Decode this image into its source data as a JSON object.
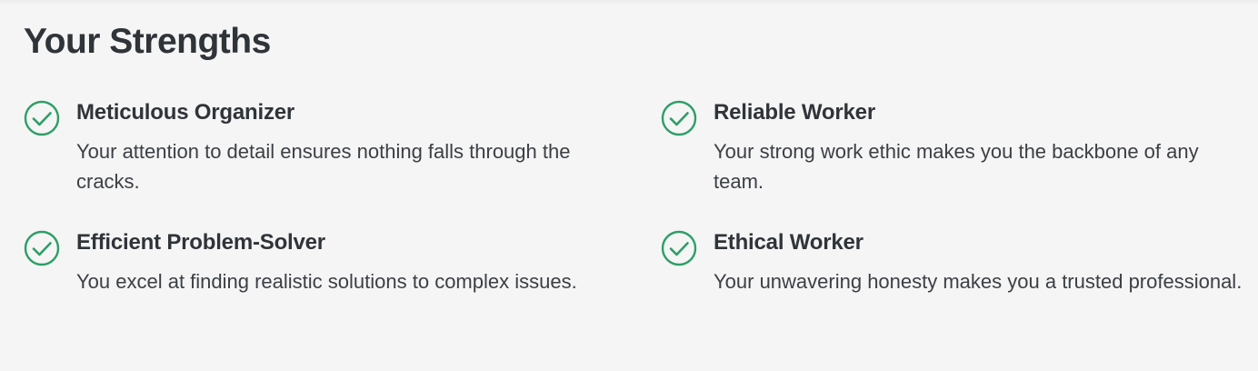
{
  "section": {
    "title": "Your Strengths"
  },
  "colors": {
    "accent": "#2e9e67",
    "heading": "#2f3439",
    "body_text": "#3b4045",
    "background": "#f5f5f5"
  },
  "strengths": [
    {
      "icon": "check-circle-icon",
      "title": "Meticulous Organizer",
      "description": "Your attention to detail ensures nothing falls through the cracks."
    },
    {
      "icon": "check-circle-icon",
      "title": "Reliable Worker",
      "description": "Your strong work ethic makes you the backbone of any team."
    },
    {
      "icon": "check-circle-icon",
      "title": "Efficient Problem-Solver",
      "description": "You excel at finding realistic solutions to complex issues."
    },
    {
      "icon": "check-circle-icon",
      "title": "Ethical Worker",
      "description": "Your unwavering honesty makes you a trusted professional."
    }
  ]
}
